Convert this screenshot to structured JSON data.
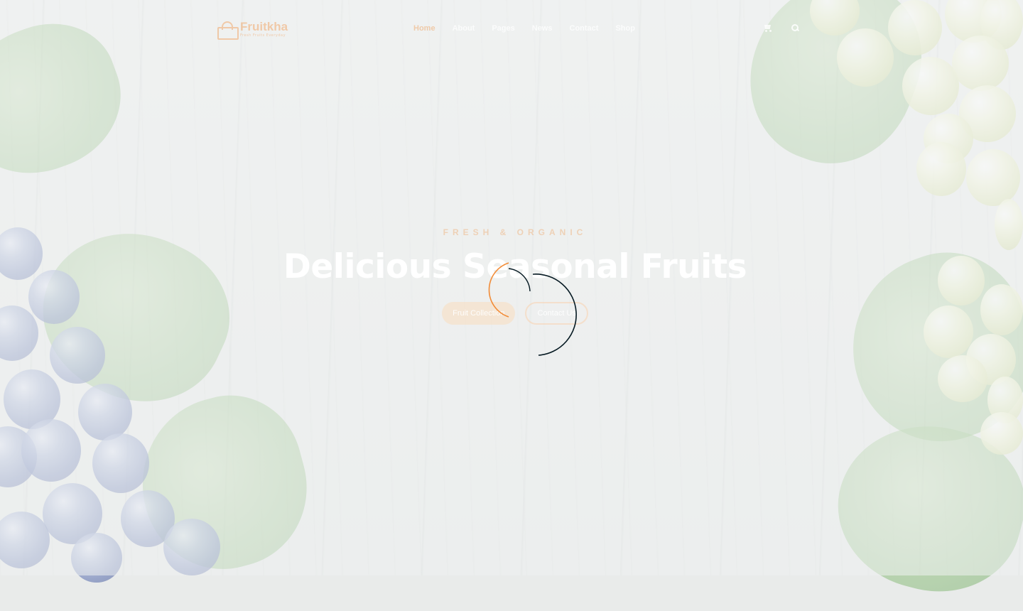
{
  "brand": {
    "name": "Fruitkha",
    "tagline": "Fresh Fruits Everyday"
  },
  "nav": {
    "items": [
      {
        "label": "Home",
        "active": true
      },
      {
        "label": "About",
        "active": false
      },
      {
        "label": "Pages",
        "active": false
      },
      {
        "label": "News",
        "active": false
      },
      {
        "label": "Contact",
        "active": false
      },
      {
        "label": "Shop",
        "active": false
      }
    ]
  },
  "header_icons": {
    "cart": "cart-icon",
    "search": "search-icon"
  },
  "hero": {
    "subtitle": "FRESH & ORGANIC",
    "title": "Delicious Seasonal Fruits",
    "primary_button": "Fruit Collection",
    "secondary_button": "Contact Us"
  },
  "colors": {
    "accent": "#F28123",
    "loader_dark": "#051922"
  }
}
